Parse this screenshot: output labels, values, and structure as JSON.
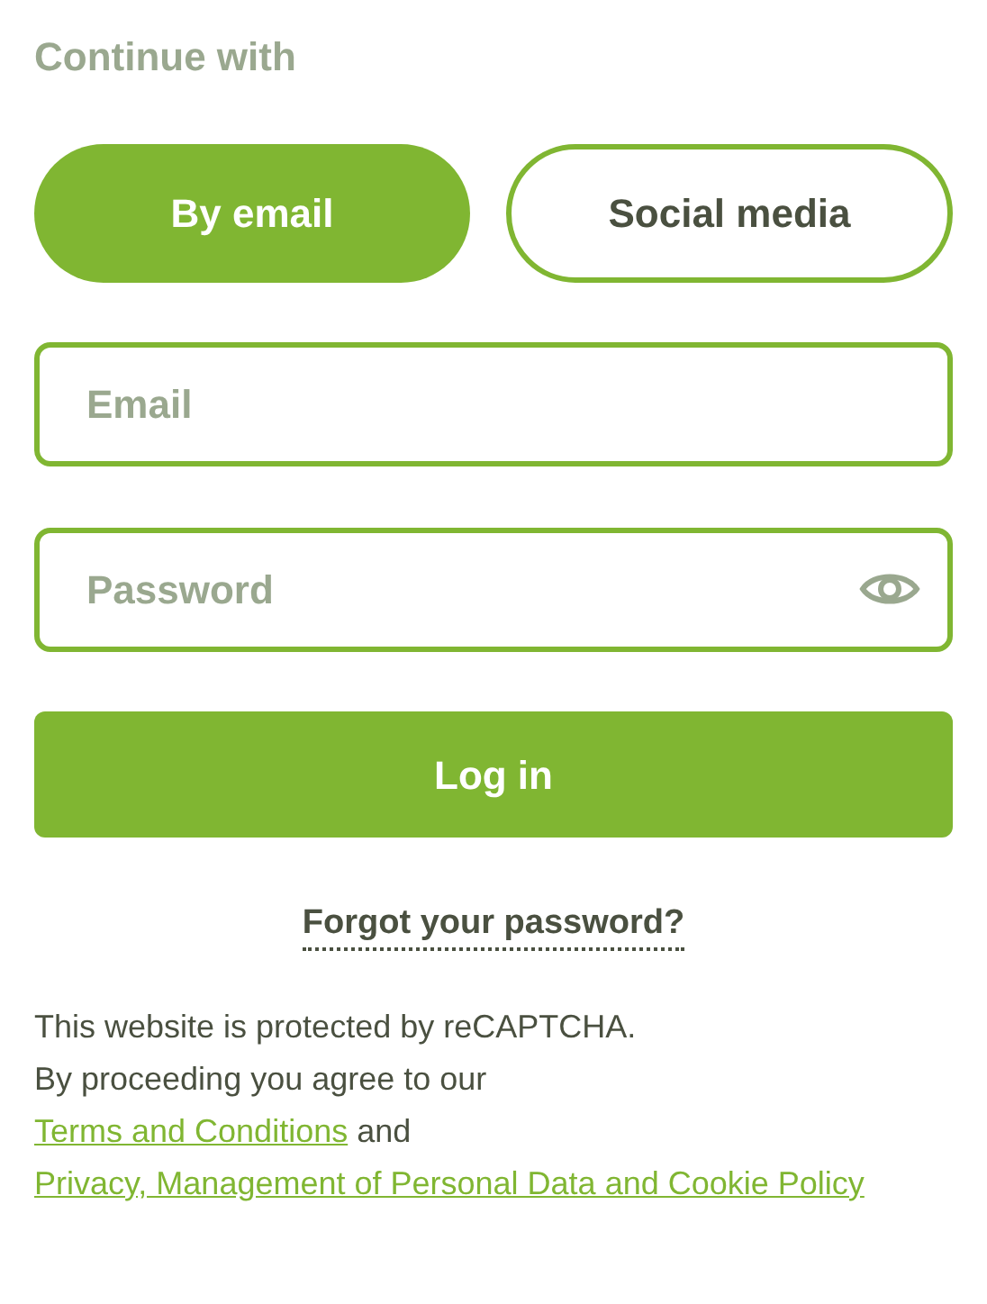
{
  "heading": "Continue with",
  "methods": [
    {
      "label": "By email",
      "selected": true
    },
    {
      "label": "Social media",
      "selected": false
    }
  ],
  "fields": [
    {
      "placeholder": "Email",
      "kind": "text"
    },
    {
      "placeholder": "Password",
      "kind": "password"
    }
  ],
  "submit": "Log in",
  "forgot_link": "Forgot your password?",
  "notice": [
    {
      "kind": "line",
      "text": "This website is protected by reCAPTCHA."
    },
    {
      "kind": "line",
      "text": "By proceeding you agree to our"
    },
    {
      "kind": "link",
      "text": "Terms and Conditions"
    },
    {
      "kind": "text",
      "text": "and"
    },
    {
      "kind": "link",
      "text": "Privacy, Management of Personal Data and Cookie Policy"
    }
  ]
}
